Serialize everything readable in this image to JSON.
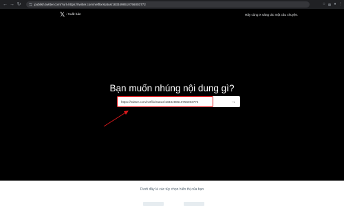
{
  "browser": {
    "url": "publish.twitter.com/?url=https://twitter.com/netflix/status/1833498510756003772",
    "icons": [
      "back-arrow-icon",
      "forward-arrow-icon",
      "reload-icon",
      "tune-icon",
      "star-icon",
      "extension-icon",
      "profile-icon",
      "menu-icon"
    ]
  },
  "header": {
    "logo": "𝕏",
    "separator": "/",
    "publish_label": "Xuất bản",
    "tagline": "Hãy cùng X sáng tác một câu chuyện."
  },
  "main": {
    "heading": "Bạn muốn nhúng nội dung gì?",
    "url_input": "https://twitter.com/netflix/status/1833498510756003772",
    "submit_arrow": "→"
  },
  "annotation": {
    "color": "#e0191c"
  },
  "below": {
    "text": "Dưới đây là các tùy chọn hiển thị của bạn"
  },
  "colors": {
    "background": "#000000",
    "highlight": "#e0191c",
    "text": "#e7e9ea"
  }
}
